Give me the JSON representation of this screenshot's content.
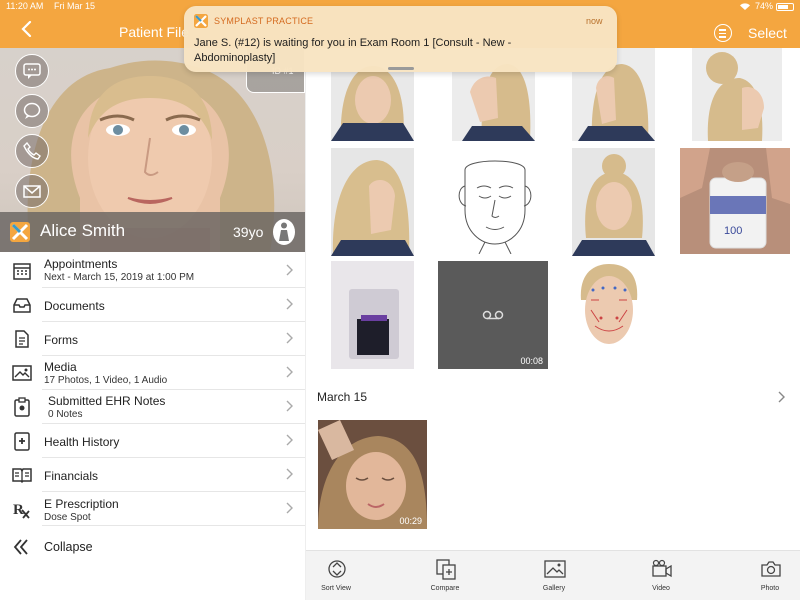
{
  "status_bar": {
    "time": "11:20 AM",
    "date": "Fri Mar 15",
    "battery": "74%",
    "battery_level": 0.74
  },
  "nav": {
    "back_icon": "chevron-left-icon",
    "title": "Patient File",
    "menu_icon": "hamburger-icon",
    "select_label": "Select"
  },
  "colors": {
    "accent": "#f4a640",
    "toast_bg": "#f8e4c2",
    "toast_app": "#d46a1f"
  },
  "notification": {
    "app_name": "SYMPLAST PRACTICE",
    "time": "now",
    "message": "Jane S. (#12) is waiting for you in Exam Room 1 [Consult - New - Abdominoplasty]"
  },
  "patient": {
    "id": "ID #1",
    "name": "Alice Smith",
    "age": "39yo",
    "actions": [
      "sms-icon",
      "chat-icon",
      "phone-icon",
      "email-icon"
    ]
  },
  "menu": [
    {
      "icon": "calendar-icon",
      "label": "Appointments",
      "sub": "Next - March 15, 2019 at 1:00 PM"
    },
    {
      "icon": "inbox-icon",
      "label": "Documents",
      "sub": ""
    },
    {
      "icon": "form-icon",
      "label": "Forms",
      "sub": ""
    },
    {
      "icon": "image-icon",
      "label": "Media",
      "sub": "17 Photos, 1 Video, 1 Audio"
    },
    {
      "icon": "clipboard-icon",
      "label": "Submitted EHR Notes",
      "sub": "0 Notes"
    },
    {
      "icon": "health-icon",
      "label": "Health History",
      "sub": ""
    },
    {
      "icon": "ledger-icon",
      "label": "Financials",
      "sub": ""
    },
    {
      "icon": "rx-icon",
      "label": "E Prescription",
      "sub": "Dose Spot"
    },
    {
      "icon": "collapse-icon",
      "label": "Collapse",
      "sub": ""
    }
  ],
  "gallery": {
    "audio_duration": "00:08",
    "date_header": "March 15",
    "video_duration": "00:29"
  },
  "toolbar": [
    {
      "icon": "sort-view-icon",
      "label": "Sort View"
    },
    {
      "icon": "compare-icon",
      "label": "Compare"
    },
    {
      "icon": "gallery-icon",
      "label": "Gallery"
    },
    {
      "icon": "video-icon",
      "label": "Video"
    },
    {
      "icon": "camera-icon",
      "label": "Photo"
    }
  ]
}
